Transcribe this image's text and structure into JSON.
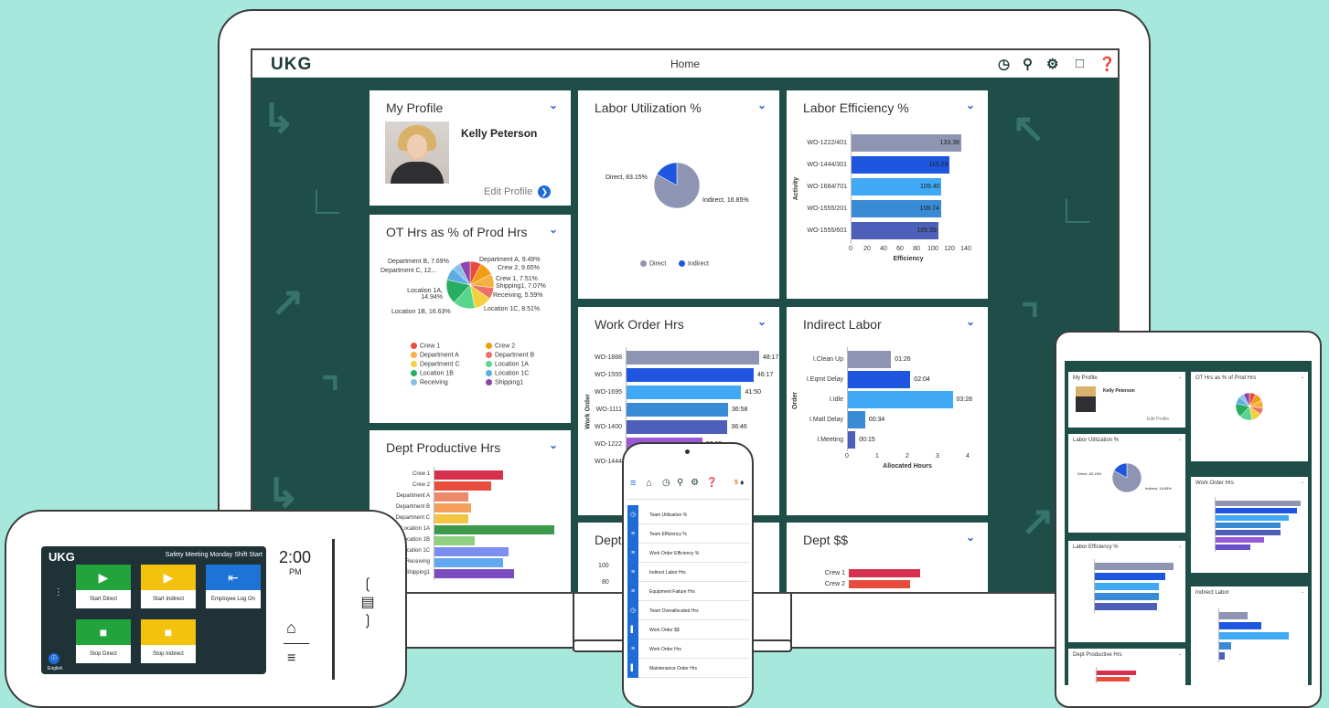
{
  "app": {
    "logo": "UKG",
    "title": "Home"
  },
  "toolbar": {
    "icons": [
      "clock-history-icon",
      "search-icon",
      "gear-icon",
      "chat-icon",
      "help-icon"
    ]
  },
  "my_profile": {
    "title": "My Profile",
    "name": "Kelly Peterson",
    "edit_label": "Edit Profile"
  },
  "labor_utilization": {
    "title": "Labor Utilization %",
    "chart_data": {
      "type": "pie",
      "title": "Labor Utilization %",
      "labels": [
        "Direct",
        "Indirect"
      ],
      "values": [
        83.15,
        16.85
      ],
      "colors": [
        "#8e95b3",
        "#1e56e0"
      ],
      "data_labels": [
        "Direct, 83.15%",
        "Indirect, 16.85%"
      ]
    }
  },
  "labor_efficiency": {
    "title": "Labor Efficiency %",
    "chart_data": {
      "type": "bar",
      "orientation": "horizontal",
      "title": "Labor Efficiency %",
      "categories": [
        "WO-1222/401",
        "WO-1444/301",
        "WO-1684/701",
        "WO-1555/201",
        "WO-1555/601"
      ],
      "values": [
        133.38,
        119.29,
        109.4,
        108.74,
        105.59
      ],
      "value_labels": [
        "133.38",
        "119.29",
        "109.40",
        "108.74",
        "105.59"
      ],
      "colors": [
        "#8e95b3",
        "#1e56e0",
        "#3fa9f5",
        "#3a8bd6",
        "#4d5fb8"
      ],
      "xlabel": "Efficiency",
      "ylabel": "Activity",
      "xlim": [
        0,
        140
      ],
      "xticks": [
        "0",
        "20",
        "40",
        "60",
        "80",
        "100",
        "120",
        "140"
      ]
    }
  },
  "ot_hrs": {
    "title": "OT Hrs as % of Prod Hrs",
    "chart_data": {
      "type": "pie",
      "title": "OT Hrs as % of Prod Hrs",
      "labels": [
        "Crew 1",
        "Crew 2",
        "Department A",
        "Department B",
        "Department C",
        "Location 1A",
        "Location 1B",
        "Location 1C",
        "Receiving",
        "Shipping1"
      ],
      "values": [
        7.51,
        9.65,
        9.49,
        7.69,
        12.0,
        14.94,
        16.63,
        8.51,
        5.59,
        7.07
      ],
      "colors": [
        "#e74c3c",
        "#f39c12",
        "#f5b041",
        "#ec7063",
        "#f4d03f",
        "#58d68d",
        "#27ae60",
        "#5dade2",
        "#85c1e9",
        "#8e44ad"
      ],
      "data_labels": [
        "Department B, 7.69%",
        "Department A, 9.49%",
        "Department C, 12...",
        "Crew 2, 9.65%",
        "Crew 1, 7.51%",
        "Shipping1, 7.07%",
        "Location 1A, 14.94%",
        "Receiving, 5.59%",
        "Location 1B, 16.63%",
        "Location 1C, 8.51%"
      ]
    },
    "legend": [
      "Crew 1",
      "Crew 2",
      "Department A",
      "Department B",
      "Department C",
      "Location 1A",
      "Location 1B",
      "Location 1C",
      "Receiving",
      "Shipping1"
    ]
  },
  "work_order_hrs": {
    "title": "Work Order Hrs",
    "chart_data": {
      "type": "bar",
      "orientation": "horizontal",
      "title": "Work Order Hrs",
      "categories": [
        "WO-1888",
        "WO-1555",
        "WO-1695",
        "WO-1111",
        "WO-1400",
        "WO-1222",
        "WO-1444"
      ],
      "values": [
        48.28,
        46.28,
        41.83,
        36.97,
        36.77,
        27.55,
        20.0
      ],
      "value_labels": [
        "48:17",
        "46:17",
        "41:50",
        "36:58",
        "36:46",
        "27:33",
        ""
      ],
      "colors": [
        "#8e95b3",
        "#1e56e0",
        "#3fa9f5",
        "#3a8bd6",
        "#4d5fb8",
        "#9b59d6",
        "#6a4fc8"
      ],
      "ylabel": "Work Order",
      "xtick_visible": "50"
    }
  },
  "indirect_labor": {
    "title": "Indirect Labor",
    "chart_data": {
      "type": "bar",
      "orientation": "horizontal",
      "title": "Indirect Labor",
      "categories": [
        "I.Clean Up",
        "I.Eqmt Delay",
        "I.Idle",
        "I.Matl Delay",
        "I.Meeting"
      ],
      "values": [
        1.43,
        2.07,
        3.47,
        0.57,
        0.25
      ],
      "value_labels": [
        "01:26",
        "02:04",
        "03:28",
        "00:34",
        "00:15"
      ],
      "colors": [
        "#8e95b3",
        "#1e56e0",
        "#3fa9f5",
        "#3a8bd6",
        "#4d5fb8"
      ],
      "xlabel": "Allocated Hours",
      "ylabel": "Order",
      "xlim": [
        0,
        4
      ],
      "xticks": [
        "0",
        "1",
        "2",
        "3",
        "4"
      ]
    }
  },
  "dept_productive": {
    "title": "Dept Productive Hrs",
    "chart_data": {
      "type": "bar",
      "orientation": "horizontal",
      "title": "Dept Productive Hrs",
      "categories": [
        "Crew 1",
        "Crew 2",
        "Department A",
        "Department B",
        "Department C",
        "Location 1A",
        "Location 1B",
        "Location 1C",
        "Receiving",
        "Shipping1"
      ],
      "category_labels_visible": [
        "Crew 1",
        "Crew 2",
        "Department A",
        "Department B",
        "Department C",
        "Location 1A",
        "Location 1B",
        "Location 1C",
        "Receiving",
        "Shipping1"
      ],
      "values": [
        48,
        40,
        24,
        26,
        24,
        84,
        28,
        52,
        48,
        56
      ],
      "colors": [
        "#d6304f",
        "#e74c3c",
        "#ec8a6b",
        "#f5a05a",
        "#f4c542",
        "#3d9a4c",
        "#8fd081",
        "#7c8ef0",
        "#62a8f0",
        "#7b4bbf"
      ]
    }
  },
  "dept_partial": {
    "title": "Dept",
    "yticks": [
      "100",
      "80"
    ]
  },
  "dept_dollars": {
    "title": "Dept $$",
    "categories": [
      "Crew 1",
      "Crew 2"
    ],
    "values": [
      100,
      86
    ],
    "colors": [
      "#d6304f",
      "#e74c3c"
    ]
  },
  "phone": {
    "badge": "5",
    "menu": [
      "Team Utilization %",
      "Team Efficiency %",
      "Work Order Efficiency %",
      "Indirect Labor Hrs",
      "Equipment Failure Hrs",
      "Team Overallocated Hrs",
      "Work Order $$",
      "Work Order Hrs",
      "Maintenance Order Hrs"
    ]
  },
  "timeclock": {
    "logo": "UKG",
    "banner": "Safety Meeting Monday Shift Start",
    "time": "2:00",
    "ampm": "PM",
    "language": "English",
    "buttons": [
      {
        "label": "Start Direct",
        "color": "#22a33c"
      },
      {
        "label": "Start Indirect",
        "color": "#f2c20c"
      },
      {
        "label": "Employee Log On",
        "color": "#1e74d6"
      },
      {
        "label": "Stop Direct",
        "color": "#22a33c"
      },
      {
        "label": "Stop Indirect",
        "color": "#f2c20c"
      }
    ]
  },
  "tablet": {
    "my_profile": "My Profile",
    "name": "Kelly Peterson",
    "edit": "Edit Profile",
    "ot": "OT Hrs as % of Prod Hrs",
    "util": "Labor Utilization %",
    "util_direct": "Direct, 83.15%",
    "util_indirect": "Indirect, 16.85%",
    "wo": "Work Order Hrs",
    "eff": "Labor Efficiency %",
    "indirect": "Indirect Labor",
    "dept": "Dept Productive Hrs"
  }
}
